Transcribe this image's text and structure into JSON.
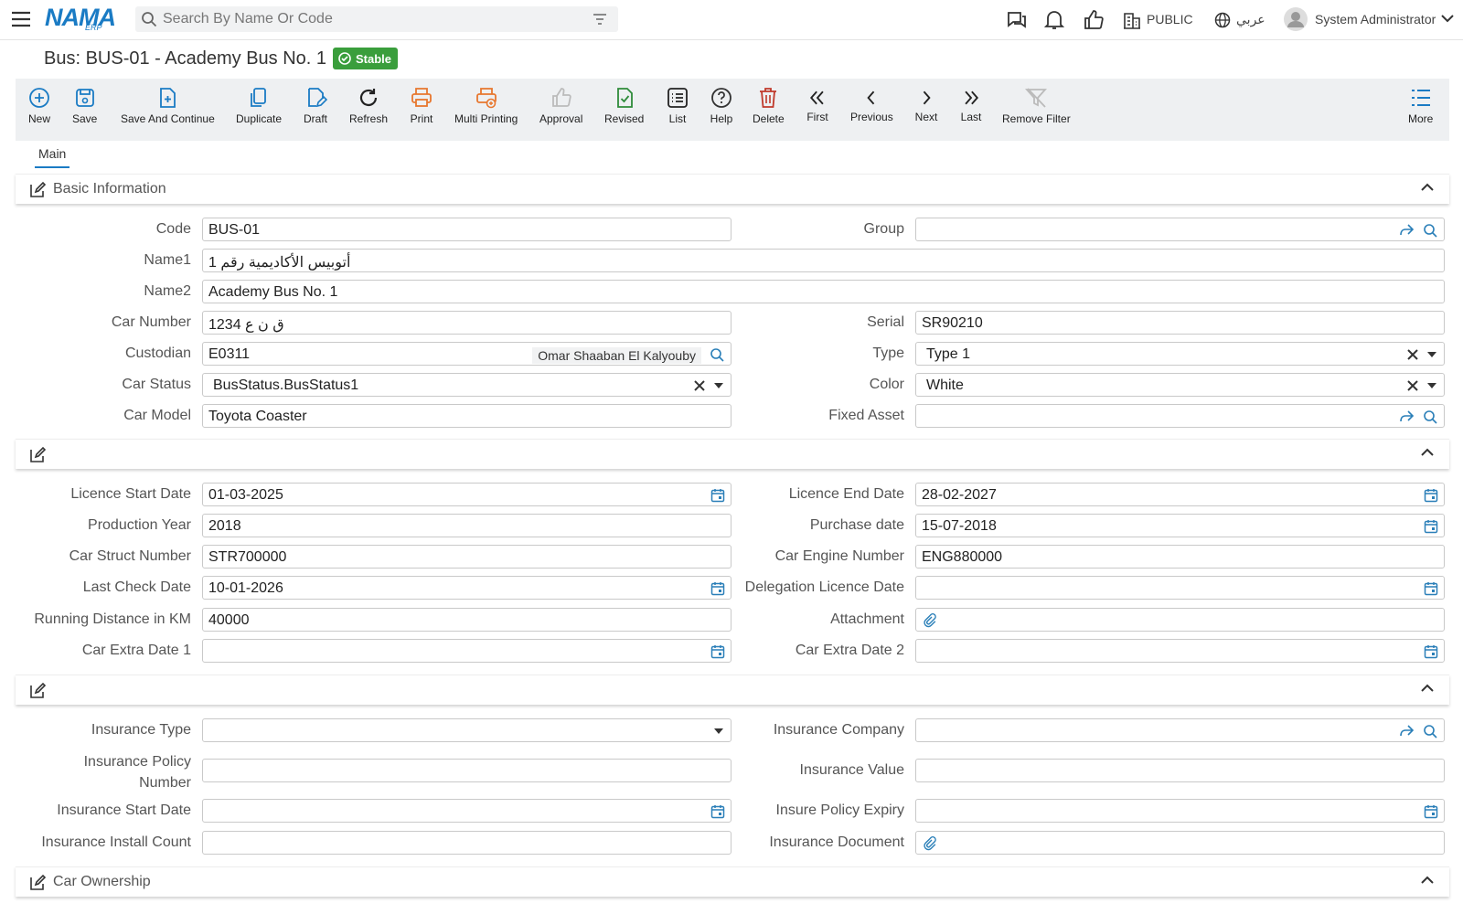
{
  "topbar": {
    "logo": "NAMA",
    "logo_sub": "ERP",
    "search_placeholder": "Search By Name Or Code",
    "public_label": "PUBLIC",
    "language_label": "عربي",
    "user_label": "System Administrator"
  },
  "title": "Bus: BUS-01 - Academy Bus No. 1",
  "status_badge": "Stable",
  "toolbar": {
    "new": "New",
    "save": "Save",
    "save_continue": "Save And Continue",
    "duplicate": "Duplicate",
    "draft": "Draft",
    "refresh": "Refresh",
    "print": "Print",
    "multi_printing": "Multi Printing",
    "approval": "Approval",
    "revised": "Revised",
    "list": "List",
    "help": "Help",
    "delete": "Delete",
    "first": "First",
    "previous": "Previous",
    "next": "Next",
    "last": "Last",
    "remove_filter": "Remove Filter",
    "more": "More"
  },
  "tabs": {
    "main": "Main"
  },
  "sections": {
    "basic": "Basic Information",
    "second": "",
    "third": "",
    "ownership": "Car Ownership"
  },
  "basic": {
    "code_label": "Code",
    "code": "BUS-01",
    "group_label": "Group",
    "group": "",
    "name1_label": "Name1",
    "name1": "أتوبيس الأكاديمية رقم 1",
    "name2_label": "Name2",
    "name2": "Academy Bus No. 1",
    "car_number_label": "Car Number",
    "car_number": "ق ن ع 1234",
    "serial_label": "Serial",
    "serial": "SR90210",
    "custodian_label": "Custodian",
    "custodian": "E0311",
    "custodian_name": "Omar Shaaban El Kalyouby",
    "type_label": "Type",
    "type": "Type 1",
    "car_status_label": "Car Status",
    "car_status": "BusStatus.BusStatus1",
    "color_label": "Color",
    "color": "White",
    "car_model_label": "Car Model",
    "car_model": "Toyota Coaster",
    "fixed_asset_label": "Fixed Asset",
    "fixed_asset": ""
  },
  "licence": {
    "licence_start_label": "Licence Start Date",
    "licence_start": "01-03-2025",
    "licence_end_label": "Licence End Date",
    "licence_end": "28-02-2027",
    "production_year_label": "Production Year",
    "production_year": "2018",
    "purchase_date_label": "Purchase date",
    "purchase_date": "15-07-2018",
    "struct_number_label": "Car Struct Number",
    "struct_number": "STR700000",
    "engine_number_label": "Car Engine Number",
    "engine_number": "ENG880000",
    "last_check_label": "Last Check Date",
    "last_check": "10-01-2026",
    "delegation_label": "Delegation Licence Date",
    "delegation": "",
    "running_distance_label": "Running Distance in KM",
    "running_distance": "40000",
    "attachment_label": "Attachment",
    "extra1_label": "Car Extra Date 1",
    "extra1": "",
    "extra2_label": "Car Extra Date 2",
    "extra2": ""
  },
  "insurance": {
    "type_label": "Insurance Type",
    "type": "",
    "company_label": "Insurance Company",
    "company": "",
    "policy_number_label_1": "Insurance Policy",
    "policy_number_label_2": "Number",
    "policy_number": "",
    "value_label": "Insurance Value",
    "value": "",
    "start_label": "Insurance Start Date",
    "start": "",
    "expiry_label": "Insure Policy Expiry",
    "expiry": "",
    "install_count_label": "Insurance Install Count",
    "install_count": "",
    "document_label": "Insurance Document"
  },
  "colors": {
    "accent": "#1a7bc4",
    "toolbar_bg": "#eef0f2",
    "stable_green": "#3a9e3c",
    "print_orange": "#e8772e",
    "delete_red": "#c0392b",
    "revised_green": "#2e8b3a"
  }
}
